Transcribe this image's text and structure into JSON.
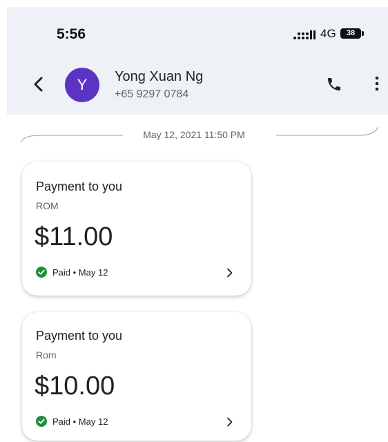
{
  "status_bar": {
    "time": "5:56",
    "network": "4G",
    "battery": "38"
  },
  "contact": {
    "initial": "Y",
    "name": "Yong Xuan Ng",
    "phone": "+65 9297 0784"
  },
  "conversation": {
    "date_divider": "May 12, 2021 11:50 PM"
  },
  "payments": [
    {
      "title": "Payment to you",
      "subtitle": "ROM",
      "amount": "$11.00",
      "status": "Paid • May 12"
    },
    {
      "title": "Payment to you",
      "subtitle": "Rom",
      "amount": "$10.00",
      "status": "Paid • May 12"
    }
  ],
  "colors": {
    "avatar": "#5b34c4",
    "paid_check": "#1e8e3e",
    "header_bg": "#eef1f6"
  },
  "icons": {
    "back": "arrow-back-icon",
    "call": "phone-icon",
    "menu": "more-vert-icon",
    "signal": "signal-icon",
    "battery": "battery-icon",
    "status": "check-circle-icon",
    "open": "chevron-right-icon"
  }
}
